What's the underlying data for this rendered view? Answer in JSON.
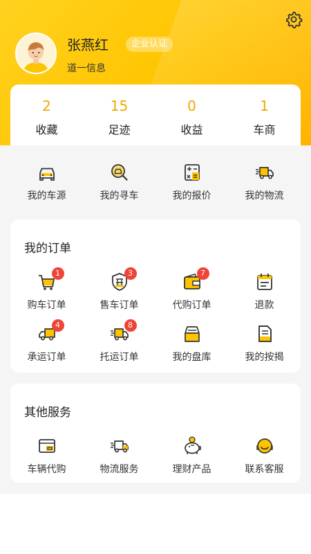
{
  "header": {
    "user_name": "张燕红",
    "cert_badge": "企业认证",
    "company": "道一信息"
  },
  "stats": [
    {
      "value": "2",
      "label": "收藏"
    },
    {
      "value": "15",
      "label": "足迹"
    },
    {
      "value": "0",
      "label": "收益"
    },
    {
      "value": "1",
      "label": "车商"
    }
  ],
  "quick_links": [
    {
      "label": "我的车源",
      "icon": "car-icon"
    },
    {
      "label": "我的寻车",
      "icon": "search-car-icon"
    },
    {
      "label": "我的报价",
      "icon": "calculator-icon"
    },
    {
      "label": "我的物流",
      "icon": "delivery-truck-icon"
    }
  ],
  "orders": {
    "title": "我的订单",
    "items": [
      {
        "label": "购车订单",
        "icon": "shopping-cart-icon",
        "badge": "1"
      },
      {
        "label": "售车订单",
        "icon": "sale-shield-icon",
        "badge": "3"
      },
      {
        "label": "代购订单",
        "icon": "wallet-icon",
        "badge": "7"
      },
      {
        "label": "退款",
        "icon": "calendar-refund-icon",
        "badge": ""
      },
      {
        "label": "承运订单",
        "icon": "truck-icon",
        "badge": "4"
      },
      {
        "label": "托运订单",
        "icon": "fast-truck-icon",
        "badge": "8"
      },
      {
        "label": "我的盘库",
        "icon": "inventory-box-icon",
        "badge": ""
      },
      {
        "label": "我的按揭",
        "icon": "mortgage-document-icon",
        "badge": ""
      }
    ]
  },
  "services": {
    "title": "其他服务",
    "items": [
      {
        "label": "车辆代购",
        "icon": "card-icon"
      },
      {
        "label": "物流服务",
        "icon": "logistics-truck-icon"
      },
      {
        "label": "理财产品",
        "icon": "piggy-bank-icon"
      },
      {
        "label": "联系客服",
        "icon": "customer-service-icon"
      }
    ]
  },
  "colors": {
    "accent": "#ffc400",
    "stat_number": "#f0a800",
    "badge": "#f04438"
  }
}
